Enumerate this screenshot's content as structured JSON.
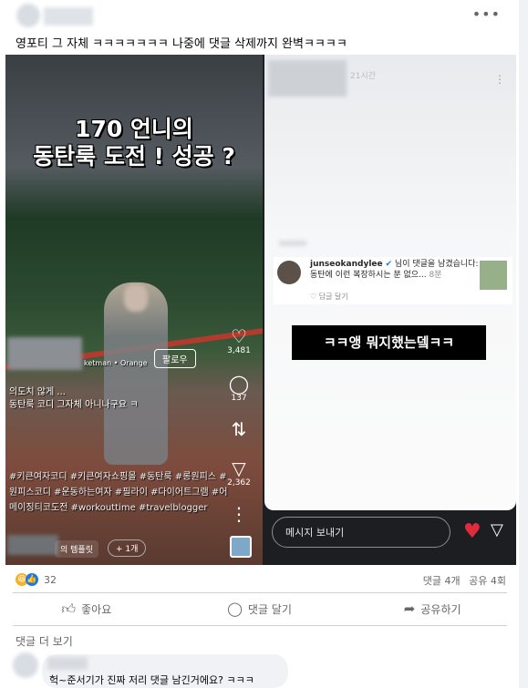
{
  "post": {
    "more_label": "•••",
    "caption": "영포티 그 자체 ㅋㅋㅋㅋㅋㅋㅋ 나중에 댓글 삭제까지 완벽ㅋㅋㅋㅋ"
  },
  "reel": {
    "title_line1": "170 언니의",
    "title_line2": "동탄룩 도전 ! 성공 ?",
    "account_suffix": "ketman • Orange",
    "follow_label": "팔로우",
    "caption_line1": "의도치 않게 ...",
    "caption_line2": "동탄룩 코디 그자체 아니나구요 ㅋ",
    "like_count": "3,481",
    "comment_count": "137",
    "share_count": "2,362",
    "hashtags": "#키큰여자코디 #키큰여자쇼핑몰 #동탄룩 #롱원피스 #원피스코디 #운동하는여자 #필라이 #다이어트그램 #어메이징티코도전 #workouttime #travelblogger",
    "template_label": "의 템플릿",
    "plus_label": "+ 1개"
  },
  "story": {
    "time": "21시간",
    "commenter": "junseokandylee",
    "comment_intro": "님이 댓글을 남겼습니다:",
    "comment_body": "동탄에 이런 복장하시는 분 없으...",
    "comment_age": "8분",
    "reply_label": "♡  답글 달기",
    "overlay_text": "ㅋㅋ앵  뭐지했는뎈ㅋㅋ",
    "message_placeholder": "메시지 보내기"
  },
  "footer": {
    "reaction_count": "32",
    "comments_stat": "댓글 4개",
    "shares_stat": "공유 4회",
    "like_label": "좋아요",
    "comment_label": "댓글 달기",
    "share_label": "공유하기",
    "more_comments": "댓글 더 보기",
    "first_comment": "헉~준서기가 진짜 저리 댓글 남긴거에요? ㅋㅋㅋ"
  },
  "colors": {
    "accent_blue": "#1877f2",
    "heart_red": "#e02b3c",
    "muted_text": "#65676b"
  },
  "icons": [
    "more-icon",
    "heart-icon",
    "comment-icon",
    "share-icon",
    "send-icon",
    "like-icon"
  ]
}
